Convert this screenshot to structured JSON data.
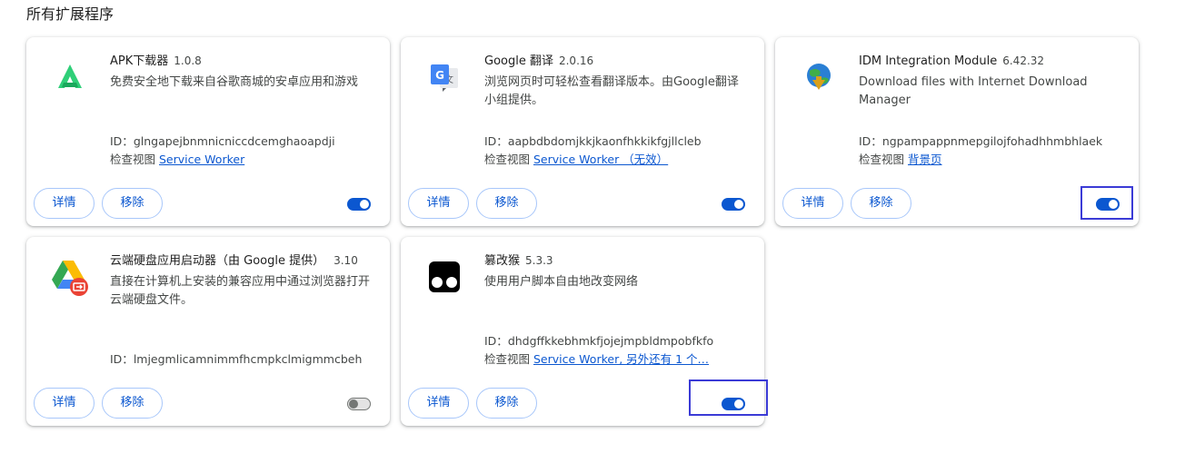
{
  "section_title": "所有扩展程序",
  "labels": {
    "details": "详情",
    "remove": "移除",
    "id_prefix": "ID：",
    "inspect_prefix": "检查视图"
  },
  "extensions": [
    {
      "name": "APK下载器",
      "version": "1.0.8",
      "description": "免费安全地下载来自谷歌商城的安卓应用和游戏",
      "id": "glngapejbnmnicniccdcemghaoapdji",
      "inspect_link": "Service Worker",
      "enabled": true,
      "icon": "apk-downloader-icon"
    },
    {
      "name": "Google 翻译",
      "version": "2.0.16",
      "description": "浏览网页时可轻松查看翻译版本。由Google翻译小组提供。",
      "id": "aapbdbdomjkkjkaonfhkkikfgjllcleb",
      "inspect_link": "Service Worker （无效）",
      "enabled": true,
      "icon": "google-translate-icon"
    },
    {
      "name": "IDM Integration Module",
      "version": "6.42.32",
      "description": "Download files with Internet Download Manager",
      "id": "ngpampappnmepgilojfohadhhmbhlaek",
      "inspect_link": "背景页",
      "enabled": true,
      "icon": "idm-icon"
    },
    {
      "name": "云端硬盘应用启动器（由 Google 提供）",
      "version": "3.10",
      "description": "直接在计算机上安装的兼容应用中通过浏览器打开云端硬盘文件。",
      "id": "lmjegmlicamnimmfhcmpkclmigmmcbeh",
      "inspect_link": "",
      "enabled": false,
      "icon": "google-drive-launcher-icon"
    },
    {
      "name": "篡改猴",
      "version": "5.3.3",
      "description": "使用用户脚本自由地改变网络",
      "id": "dhdgffkkebhmkfjojejmpbldmpobfkfo",
      "inspect_link": "Service Worker, 另外还有 1 个…",
      "enabled": true,
      "icon": "tampermonkey-icon"
    }
  ],
  "colors": {
    "accent": "#0b57d0",
    "button_border": "#a8c7fa",
    "focus_box": "#3b3bd6"
  }
}
